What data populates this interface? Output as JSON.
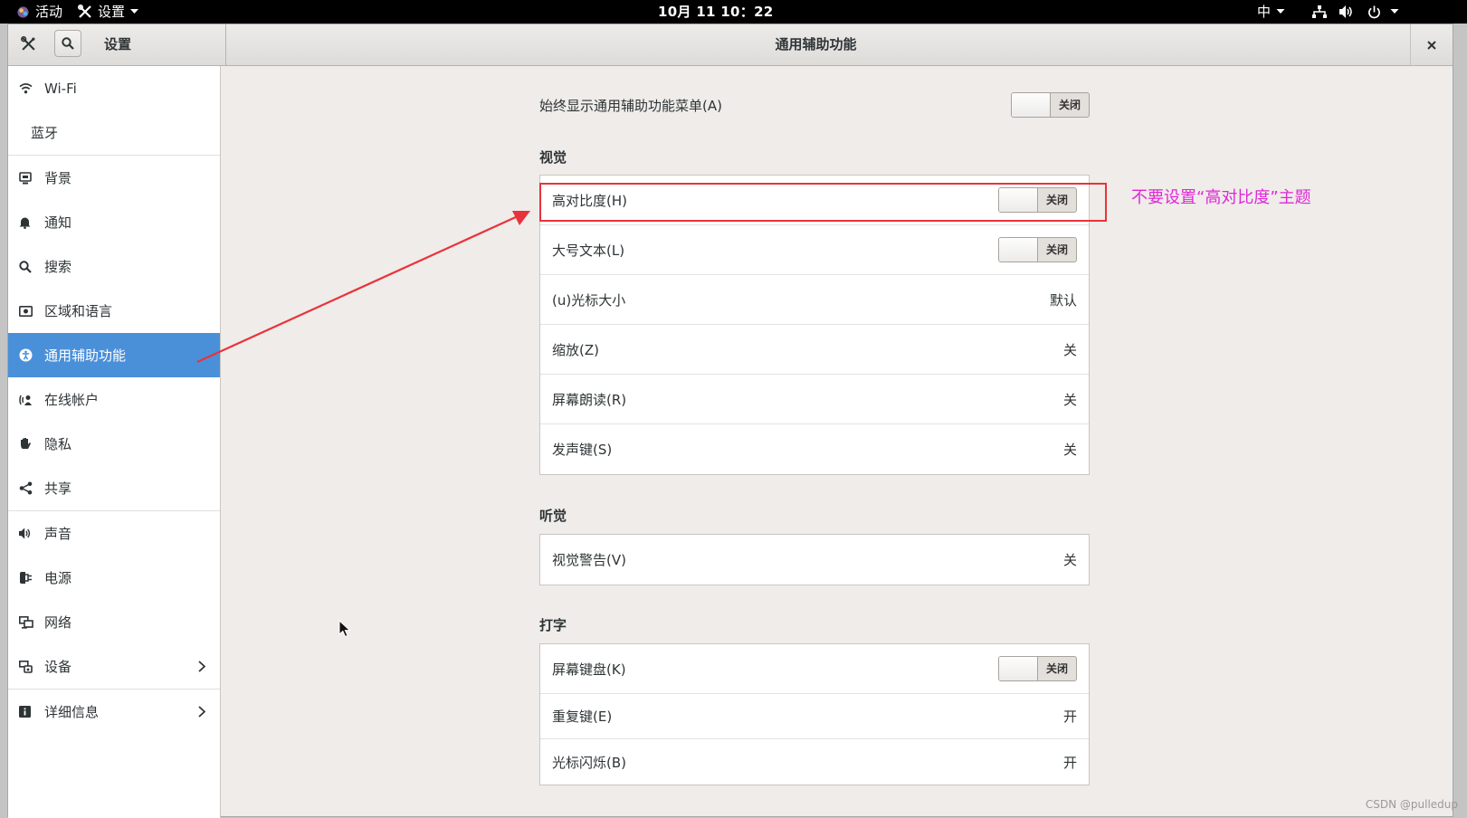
{
  "topbar": {
    "activities": "活动",
    "app_menu": "设置",
    "clock": "10月 11  10：22",
    "input_method": "中"
  },
  "headerbar": {
    "sidebar_title": "设置",
    "panel_title": "通用辅助功能"
  },
  "sidebar": {
    "items": [
      {
        "label": "Wi-Fi",
        "icon": "wifi-icon"
      },
      {
        "label": "蓝牙",
        "icon": ""
      },
      {
        "label": "背景",
        "icon": "background-icon"
      },
      {
        "label": "通知",
        "icon": "bell-icon"
      },
      {
        "label": "搜索",
        "icon": "search-icon"
      },
      {
        "label": "区域和语言",
        "icon": "region-icon"
      },
      {
        "label": "通用辅助功能",
        "icon": "accessibility-icon",
        "active": true
      },
      {
        "label": "在线帐户",
        "icon": "online-accounts-icon"
      },
      {
        "label": "隐私",
        "icon": "hand-icon"
      },
      {
        "label": "共享",
        "icon": "share-icon"
      },
      {
        "label": "声音",
        "icon": "speaker-icon"
      },
      {
        "label": "电源",
        "icon": "power-plug-icon"
      },
      {
        "label": "网络",
        "icon": "network-icon"
      },
      {
        "label": "设备",
        "icon": "devices-icon"
      },
      {
        "label": "详细信息",
        "icon": "info-icon"
      }
    ]
  },
  "main": {
    "always_show": {
      "label": "始终显示通用辅助功能菜单(A)",
      "state": "关闭"
    },
    "vision": {
      "title": "视觉",
      "rows": [
        {
          "label": "高对比度(H)",
          "state": "关闭"
        },
        {
          "label": "大号文本(L)",
          "state": "关闭"
        },
        {
          "label": "(u)光标大小",
          "value": "默认"
        },
        {
          "label": "缩放(Z)",
          "value": "关"
        },
        {
          "label": "屏幕朗读(R)",
          "value": "关"
        },
        {
          "label": "发声键(S)",
          "value": "关"
        }
      ]
    },
    "hearing": {
      "title": "听觉",
      "rows": [
        {
          "label": "视觉警告(V)",
          "value": "关"
        }
      ]
    },
    "typing": {
      "title": "打字",
      "rows": [
        {
          "label": "屏幕键盘(K)",
          "state": "关闭"
        },
        {
          "label": "重复键(E)",
          "value": "开"
        },
        {
          "label": "光标闪烁(B)",
          "value": "开"
        }
      ]
    }
  },
  "annotation": {
    "text": "不要设置“高对比度”主题",
    "color": "#e026d8",
    "box_color": "#e8333a"
  },
  "watermark": "CSDN @pulledup",
  "colors": {
    "accent": "#4a90d9",
    "topbar": "#000000",
    "content_bg": "#efece9"
  }
}
